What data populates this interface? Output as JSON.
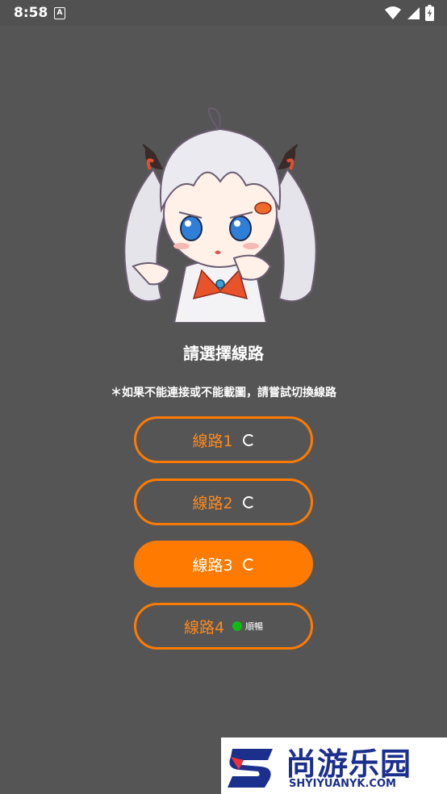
{
  "status_bar": {
    "time": "8:58",
    "notification_icon": "a-icon",
    "icons": [
      "wifi-icon",
      "signal-icon",
      "battery-icon"
    ]
  },
  "main": {
    "mascot": "anime-girl-mascot",
    "title": "請選擇線路",
    "hint": "＊如果不能連接或不能載圖，請嘗試切換線路",
    "routes": [
      {
        "label": "線路1",
        "state": "loading"
      },
      {
        "label": "線路2",
        "state": "loading"
      },
      {
        "label": "線路3",
        "state": "loading",
        "selected": true
      },
      {
        "label": "線路4",
        "state": "ok",
        "status": "順暢",
        "status_color": "#14b814"
      }
    ]
  },
  "watermark": {
    "name_cn": "尚游乐园",
    "name_en": "SHYIYUANYK.COM"
  },
  "colors": {
    "background": "#555555",
    "accent": "#ff7a00",
    "ok": "#14b814"
  }
}
